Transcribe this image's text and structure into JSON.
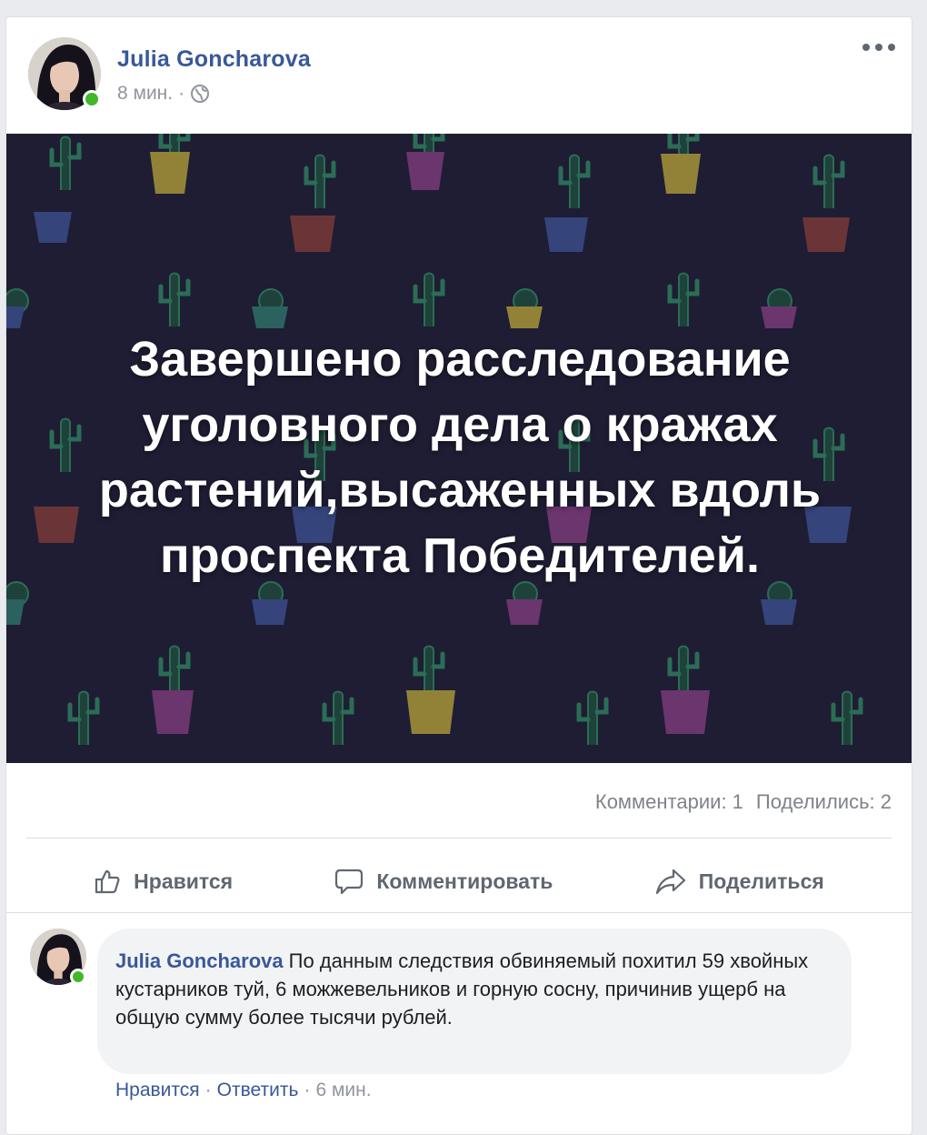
{
  "post": {
    "author": "Julia Goncharova",
    "time": "8 мин.",
    "separator": "·",
    "image_text": "Завершено расследование уголовного дела о кражах растений,высаженных вдоль проспекта Победителей."
  },
  "stats": {
    "comments": "Комментарии: 1",
    "shares": "Поделились: 2"
  },
  "actions": {
    "like": "Нравится",
    "comment": "Комментировать",
    "share": "Поделиться"
  },
  "comment": {
    "author": "Julia Goncharova",
    "text": "По данным следствия обвиняемый похитил 59 хвойных кустарников туй, 6 можжевельников и горную сосну, причинив ущерб на общую сумму более тысячи рублей.",
    "like": "Нравится",
    "reply": "Ответить",
    "time": "6 мин.",
    "separator": "·"
  },
  "colors": {
    "link": "#385898",
    "online": "#42b72a",
    "image_bg": "#1e1d33"
  },
  "icons": [
    "more-icon",
    "globe-icon",
    "like-icon",
    "comment-icon",
    "share-icon"
  ]
}
